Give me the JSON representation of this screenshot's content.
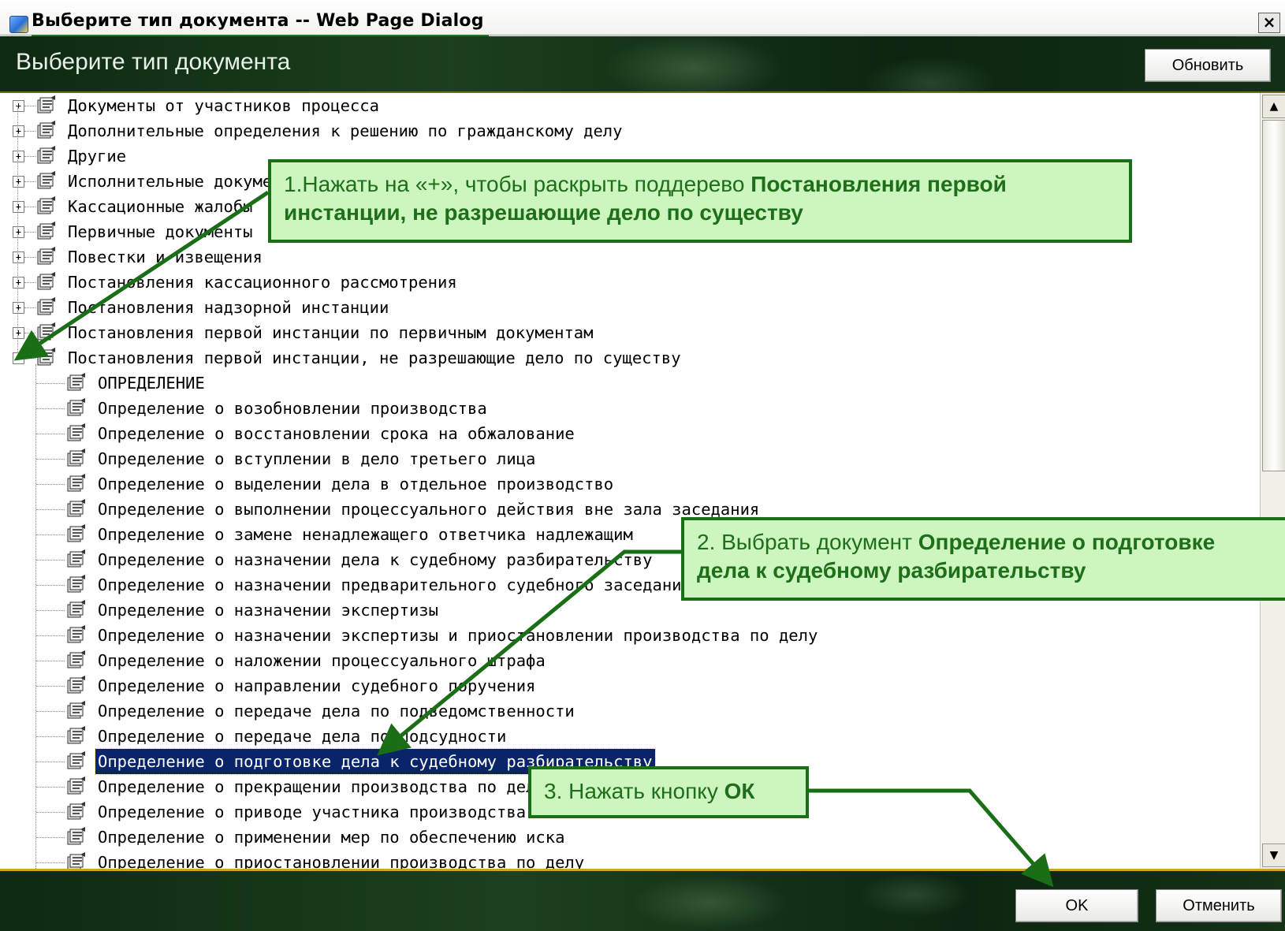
{
  "window": {
    "title": "Выберите тип документа -- Web Page Dialog",
    "close_label": "×"
  },
  "header": {
    "title": "Выберите тип документа",
    "refresh_label": "Обновить"
  },
  "tree": {
    "root_items": [
      "Документы от участников процесса",
      "Дополнительные определения к решению по гражданскому делу",
      "Другие",
      "Исполнительные документы",
      "Кассационные жалобы",
      "Первичные документы",
      "Повестки и извещения",
      "Постановления кассационного рассмотрения",
      "Постановления надзорной инстанции",
      "Постановления первой инстанции по первичным документам",
      "Постановления первой инстанции, не разрешающие дело по существу"
    ],
    "expanded_children": [
      "ОПРЕДЕЛЕНИЕ",
      "Определение о возобновлении производства",
      "Определение о восстановлении срока на обжалование",
      "Определение о вступлении в дело третьего лица",
      "Определение о выделении дела в отдельное производство",
      "Определение о выполнении процессуального действия вне зала заседания",
      "Определение о замене ненадлежащего ответчика надлежащим",
      "Определение о назначении дела к судебному разбирательству",
      "Определение о назначении предварительного судебного заседания",
      "Определение о назначении экспертизы",
      "Определение о назначении экспертизы и приостановлении производства по делу",
      "Определение о наложении процессуального штрафа",
      "Определение о направлении судебного поручения",
      "Определение о передаче дела по подведомственности",
      "Определение о передаче дела по подсудности",
      "Определение о подготовке дела к судебному разбирательству",
      "Определение о прекращении производства по делу",
      "Определение о приводе участника производства",
      "Определение о применении мер по обеспечению иска",
      "Определение о приостановлении производства по делу"
    ],
    "selected_index": 15
  },
  "footer": {
    "ok_label": "OK",
    "cancel_label": "Отменить"
  },
  "callouts": {
    "step1_prefix": "1.Нажать на «+», чтобы раскрыть поддерево ",
    "step1_bold_a": "Постановления первой",
    "step1_bold_b": "инстанции,  не разрешающие дело по существу",
    "step2_prefix": "2. Выбрать документ ",
    "step2_bold_a": "Определение о подготовке",
    "step2_bold_b": "дела к судебному разбирательству",
    "step3_prefix": "3. Нажать кнопку ",
    "step3_bold": "ОК"
  },
  "colors": {
    "header_green": "#0e2a12",
    "callout_fill": "#ccf5c0",
    "callout_border": "#1a6e16",
    "selection": "#0a246a"
  }
}
